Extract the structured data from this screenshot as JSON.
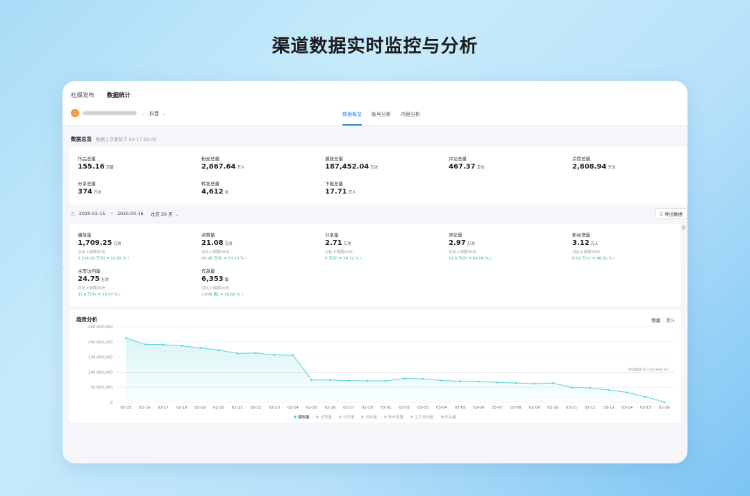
{
  "hero_title": "渠道数据实时监控与分析",
  "topnav": {
    "items": [
      "社媒发布",
      "数据统计"
    ],
    "active": 1
  },
  "subnav": {
    "org_icon": "user-group-icon",
    "platform": "抖音",
    "tabs": [
      "数据概览",
      "账号分析",
      "内容分析"
    ],
    "active_tab": 0
  },
  "overview": {
    "title": "数据总览",
    "updated": "数据上次更新于 03-17 02:00",
    "metrics": [
      {
        "label": "作品总量",
        "value": "155.16",
        "unit": "万篇"
      },
      {
        "label": "粉丝总量",
        "value": "2,867.64",
        "unit": "万人"
      },
      {
        "label": "播放总量",
        "value": "187,452.04",
        "unit": "万次"
      },
      {
        "label": "评论总量",
        "value": "467.37",
        "unit": "万次"
      },
      {
        "label": "点赞总量",
        "value": "2,808.94",
        "unit": "万次"
      },
      {
        "label": "分享总量",
        "value": "374",
        "unit": "万次"
      },
      {
        "label": "转发总量",
        "value": "4,612",
        "unit": "次"
      },
      {
        "label": "下载总量",
        "value": "17.71",
        "unit": "万人"
      }
    ]
  },
  "daterange": {
    "start": "2025-02-15",
    "sep": "→",
    "end": "2025-03-16",
    "preset": "过去 30 天",
    "export_label": "导出数据"
  },
  "period": {
    "metrics": [
      {
        "label": "播放量",
        "value": "1,709.25",
        "unit": "万次",
        "compare": "对比上周期30天",
        "change": "2,539.29 万次( ⏷ 32.65 % )"
      },
      {
        "label": "点赞量",
        "value": "21.08",
        "unit": "万次",
        "compare": "对比上周期30天",
        "change": "45.08 万次( ⏷ 53.23 % )"
      },
      {
        "label": "分享量",
        "value": "2.71",
        "unit": "万次",
        "compare": "对比上周期30天",
        "change": "6 万次( ⏷ 54.72 % )"
      },
      {
        "label": "评论量",
        "value": "2.97",
        "unit": "万次",
        "compare": "对比上周期30天",
        "change": "21.4 万次( ⏷ 86.08 % )"
      },
      {
        "label": "粉丝增量",
        "value": "3.12",
        "unit": "万人",
        "compare": "对比上周期30天",
        "change": "6.02 万人( ⏷ 48.01 % )"
      },
      {
        "label": "主页访问量",
        "value": "24.75",
        "unit": "万次",
        "compare": "对比上周期30天",
        "change": "35.4 万次( ⏷ 30.07 % )"
      },
      {
        "label": "作品量",
        "value": "6,353",
        "unit": "篇",
        "compare": "对比上周期30天",
        "change": "7,638 篇( ⏷ 16.82 % )"
      }
    ]
  },
  "trend": {
    "title": "趋势分析",
    "modes": [
      "增量",
      "累计"
    ],
    "active_mode": 1,
    "legend": [
      "播放量",
      "点赞量",
      "分享量",
      "评论量",
      "粉丝增量",
      "主页访问量",
      "作品量"
    ],
    "active_series": 0,
    "accent": "#5ad0d6"
  },
  "chart_data": {
    "type": "area",
    "title": "趋势分析",
    "x": [
      "02-15",
      "02-16",
      "02-17",
      "02-18",
      "02-19",
      "02-20",
      "02-21",
      "02-22",
      "02-23",
      "02-24",
      "02-25",
      "02-26",
      "02-27",
      "02-28",
      "03-01",
      "03-02",
      "03-03",
      "03-04",
      "03-05",
      "03-06",
      "03-07",
      "03-08",
      "03-09",
      "03-10",
      "03-11",
      "03-12",
      "03-13",
      "03-14",
      "03-15",
      "03-16"
    ],
    "series": [
      {
        "name": "播放量",
        "values": [
          213000000,
          192000000,
          191000000,
          187000000,
          180000000,
          173000000,
          162000000,
          163000000,
          157000000,
          156000000,
          74000000,
          74000000,
          72000000,
          71000000,
          71000000,
          79000000,
          78000000,
          72000000,
          70000000,
          69000000,
          66000000,
          64000000,
          62000000,
          64000000,
          49000000,
          48000000,
          41000000,
          33000000,
          18000000,
          1000000
        ]
      }
    ],
    "ylim": [
      0,
      250000000
    ],
    "yticks": [
      0,
      50000000,
      100000000,
      150000000,
      200000000,
      250000000
    ],
    "yticklabels": [
      "0",
      "50,000,000",
      "100,000,000",
      "150,000,000",
      "200,000,000",
      "250,000,000"
    ],
    "average": {
      "label": "平均值线",
      "value_text": "97,130,684.03",
      "value": 97130684.03
    },
    "grid": true
  }
}
